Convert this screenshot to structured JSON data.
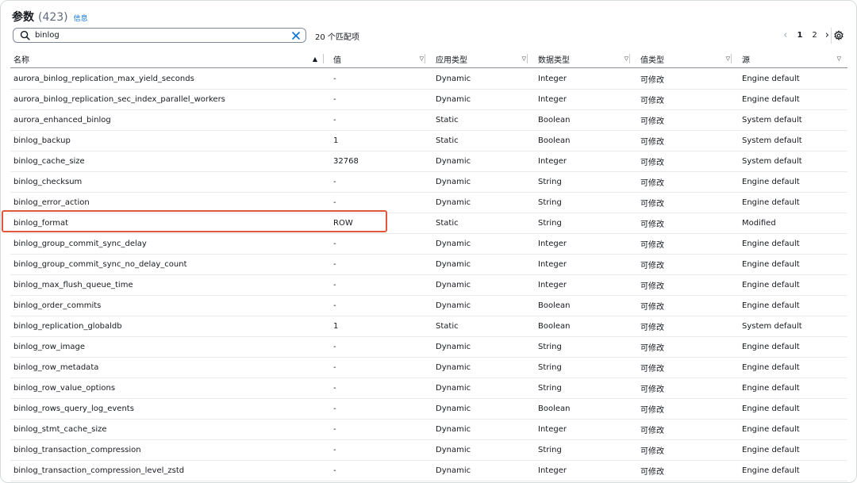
{
  "header": {
    "title": "参数",
    "count": "(423)",
    "info_link": "信息"
  },
  "search": {
    "value": "binlog",
    "matches": "20 个匹配项"
  },
  "pagination": {
    "pages": [
      "1",
      "2"
    ],
    "current": "1"
  },
  "columns": [
    {
      "label": "名称",
      "sort": "▲"
    },
    {
      "label": "值",
      "sort": "▽"
    },
    {
      "label": "应用类型",
      "sort": "▽"
    },
    {
      "label": "数据类型",
      "sort": "▽"
    },
    {
      "label": "值类型",
      "sort": "▽"
    },
    {
      "label": "源",
      "sort": "▽"
    }
  ],
  "rows": [
    {
      "name": "aurora_binlog_replication_max_yield_seconds",
      "value": "-",
      "apply": "Dynamic",
      "dtype": "Integer",
      "vtype": "可修改",
      "source": "Engine default"
    },
    {
      "name": "aurora_binlog_replication_sec_index_parallel_workers",
      "value": "-",
      "apply": "Dynamic",
      "dtype": "Integer",
      "vtype": "可修改",
      "source": "Engine default"
    },
    {
      "name": "aurora_enhanced_binlog",
      "value": "-",
      "apply": "Static",
      "dtype": "Boolean",
      "vtype": "可修改",
      "source": "System default"
    },
    {
      "name": "binlog_backup",
      "value": "1",
      "apply": "Static",
      "dtype": "Boolean",
      "vtype": "可修改",
      "source": "System default"
    },
    {
      "name": "binlog_cache_size",
      "value": "32768",
      "apply": "Dynamic",
      "dtype": "Integer",
      "vtype": "可修改",
      "source": "System default"
    },
    {
      "name": "binlog_checksum",
      "value": "-",
      "apply": "Dynamic",
      "dtype": "String",
      "vtype": "可修改",
      "source": "Engine default"
    },
    {
      "name": "binlog_error_action",
      "value": "-",
      "apply": "Dynamic",
      "dtype": "String",
      "vtype": "可修改",
      "source": "Engine default"
    },
    {
      "name": "binlog_format",
      "value": "ROW",
      "apply": "Static",
      "dtype": "String",
      "vtype": "可修改",
      "source": "Modified"
    },
    {
      "name": "binlog_group_commit_sync_delay",
      "value": "-",
      "apply": "Dynamic",
      "dtype": "Integer",
      "vtype": "可修改",
      "source": "Engine default"
    },
    {
      "name": "binlog_group_commit_sync_no_delay_count",
      "value": "-",
      "apply": "Dynamic",
      "dtype": "Integer",
      "vtype": "可修改",
      "source": "Engine default"
    },
    {
      "name": "binlog_max_flush_queue_time",
      "value": "-",
      "apply": "Dynamic",
      "dtype": "Integer",
      "vtype": "可修改",
      "source": "Engine default"
    },
    {
      "name": "binlog_order_commits",
      "value": "-",
      "apply": "Dynamic",
      "dtype": "Boolean",
      "vtype": "可修改",
      "source": "Engine default"
    },
    {
      "name": "binlog_replication_globaldb",
      "value": "1",
      "apply": "Static",
      "dtype": "Boolean",
      "vtype": "可修改",
      "source": "System default"
    },
    {
      "name": "binlog_row_image",
      "value": "-",
      "apply": "Dynamic",
      "dtype": "String",
      "vtype": "可修改",
      "source": "Engine default"
    },
    {
      "name": "binlog_row_metadata",
      "value": "-",
      "apply": "Dynamic",
      "dtype": "String",
      "vtype": "可修改",
      "source": "Engine default"
    },
    {
      "name": "binlog_row_value_options",
      "value": "-",
      "apply": "Dynamic",
      "dtype": "String",
      "vtype": "可修改",
      "source": "Engine default"
    },
    {
      "name": "binlog_rows_query_log_events",
      "value": "-",
      "apply": "Dynamic",
      "dtype": "Boolean",
      "vtype": "可修改",
      "source": "Engine default"
    },
    {
      "name": "binlog_stmt_cache_size",
      "value": "-",
      "apply": "Dynamic",
      "dtype": "Integer",
      "vtype": "可修改",
      "source": "Engine default"
    },
    {
      "name": "binlog_transaction_compression",
      "value": "-",
      "apply": "Dynamic",
      "dtype": "String",
      "vtype": "可修改",
      "source": "Engine default"
    },
    {
      "name": "binlog_transaction_compression_level_zstd",
      "value": "-",
      "apply": "Dynamic",
      "dtype": "Integer",
      "vtype": "可修改",
      "source": "Engine default"
    }
  ],
  "highlight_row": "binlog_format",
  "icons": {
    "search": "search-icon",
    "clear": "close-icon",
    "prev": "chevron-left-icon",
    "next": "chevron-right-icon",
    "settings": "gear-icon"
  },
  "colors": {
    "link": "#0972d3",
    "highlight_border": "#e2583e"
  }
}
